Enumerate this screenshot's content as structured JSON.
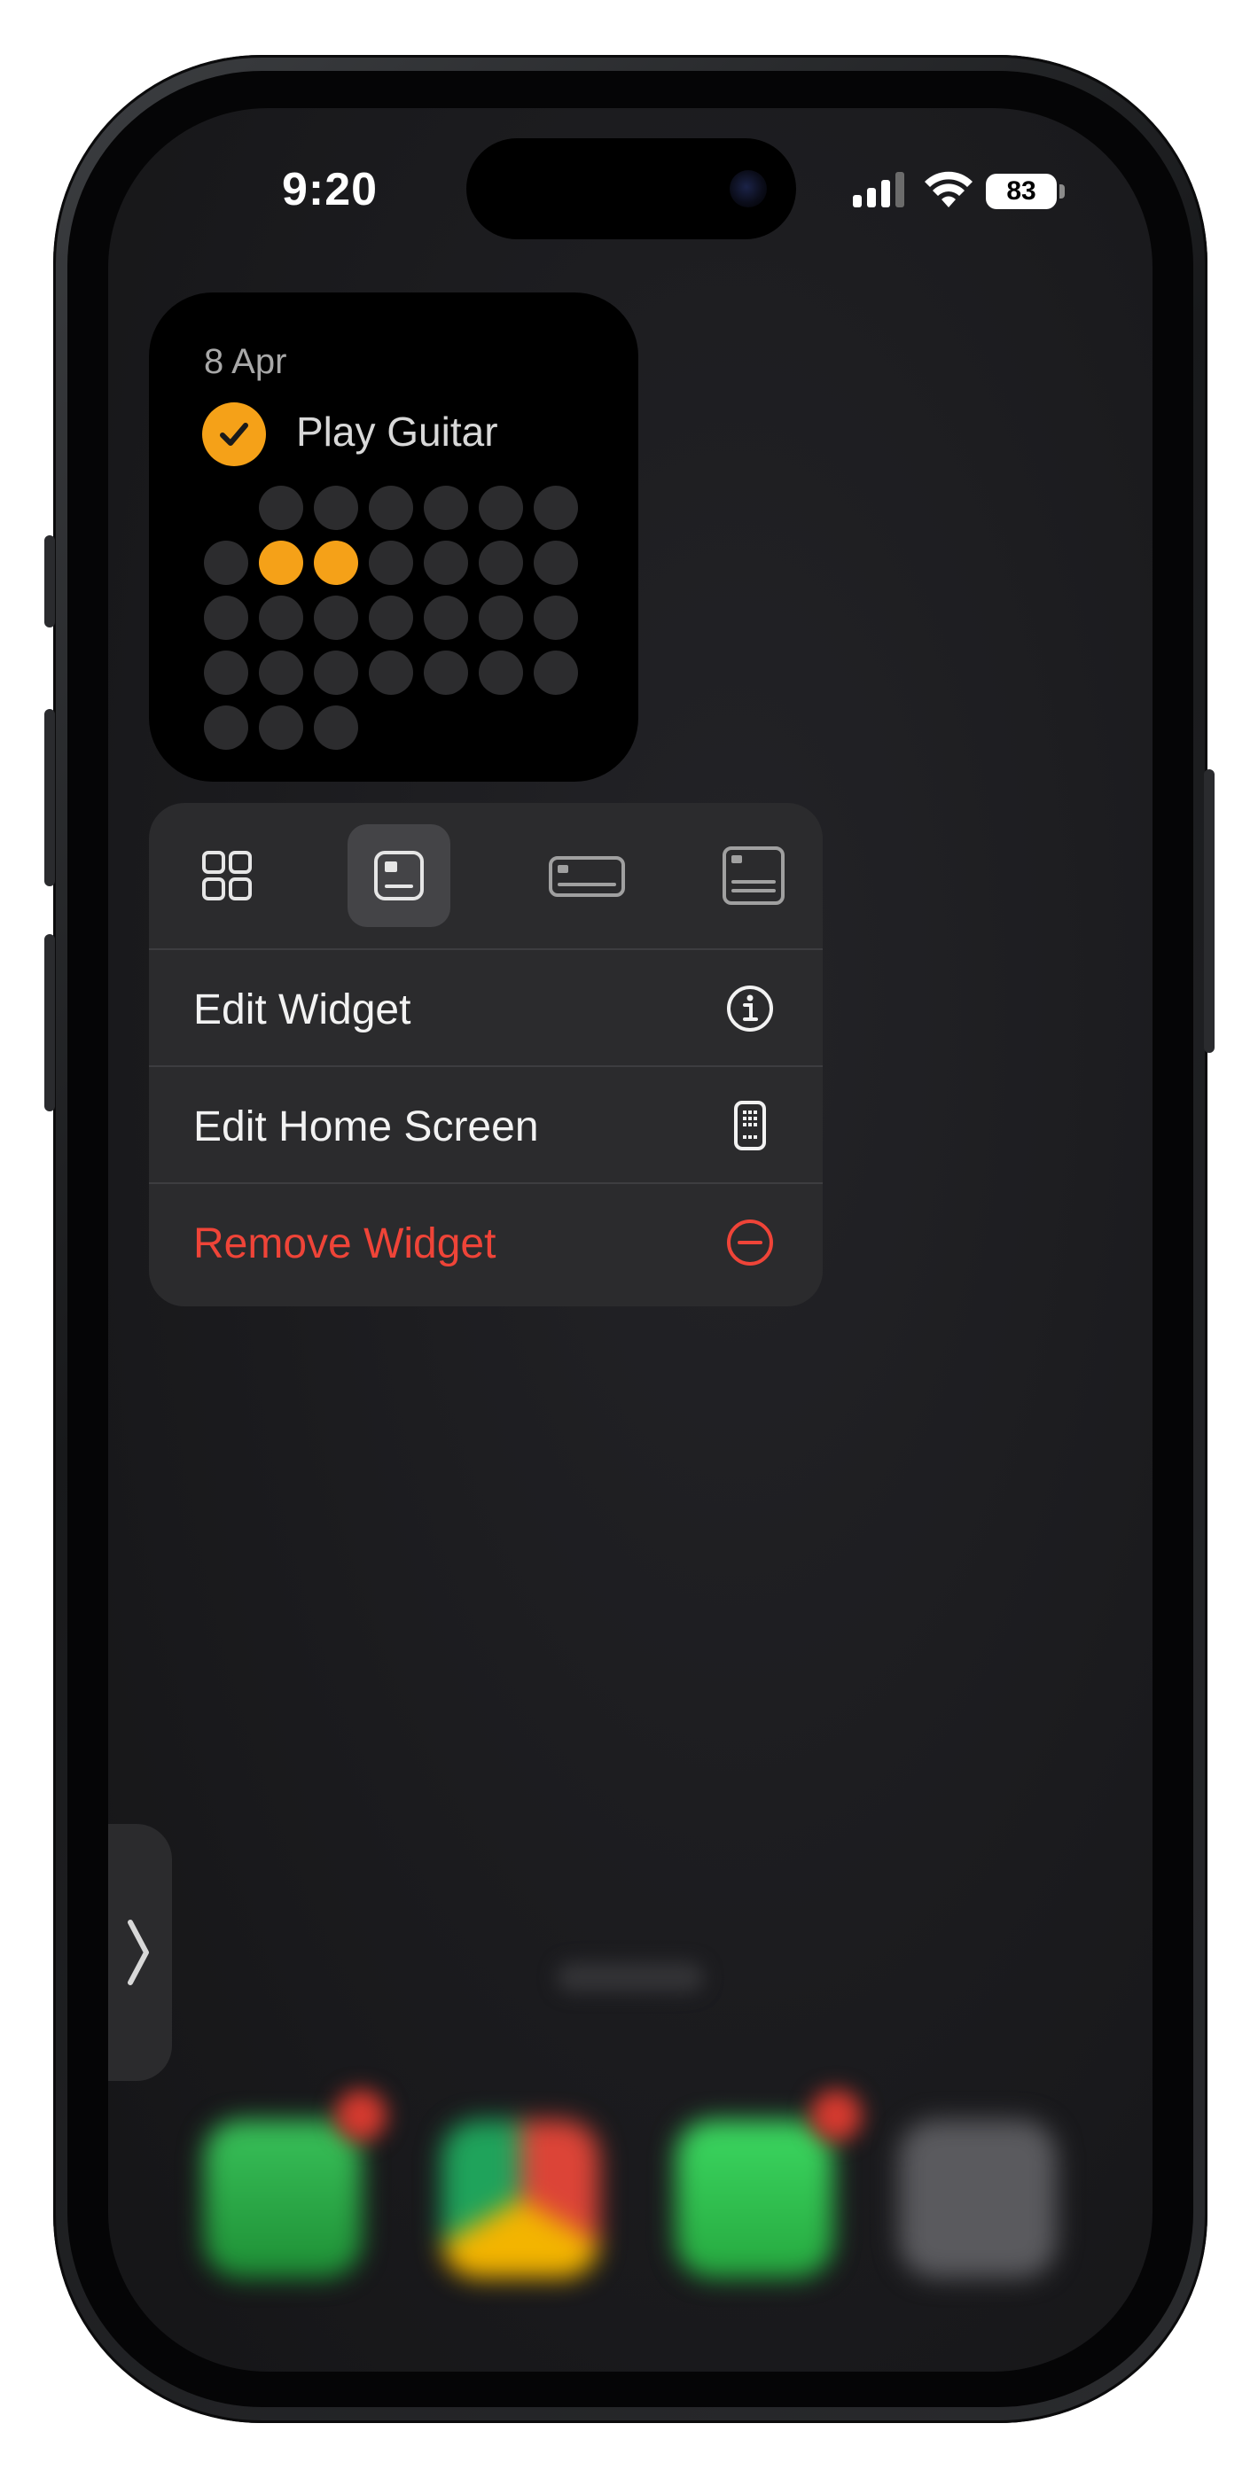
{
  "status_bar": {
    "time": "9:20",
    "battery": "83"
  },
  "widget": {
    "date": "8 Apr",
    "habit": "Play Guitar",
    "accent_color": "#f5a118",
    "days_in_month": 30,
    "completed_days": [
      8,
      9
    ]
  },
  "context_menu": {
    "size_options": [
      "small-grid-icon",
      "small-widget-icon",
      "medium-widget-icon",
      "large-widget-icon"
    ],
    "selected_size": "small",
    "items": [
      {
        "label": "Edit Widget",
        "icon": "info-icon"
      },
      {
        "label": "Edit Home Screen",
        "icon": "phone-icon"
      },
      {
        "label": "Remove Widget",
        "icon": "minus-circle-icon",
        "color": "#ef4438"
      }
    ]
  },
  "dock": {
    "apps": [
      "phone-app-icon",
      "chrome-app-icon",
      "messages-app-icon",
      "camera-app-icon"
    ]
  },
  "pull_tab": {
    "icon": "chevron-right-icon"
  }
}
